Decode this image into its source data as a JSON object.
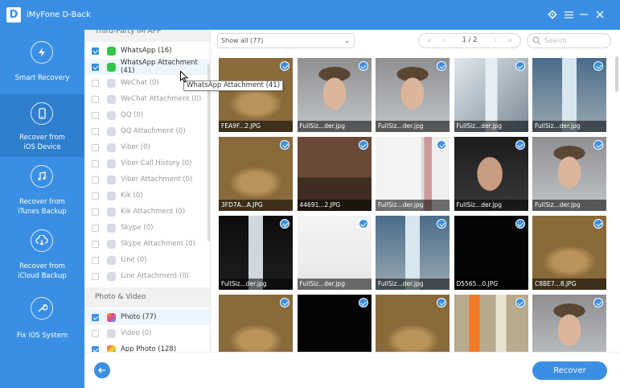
{
  "window": {
    "title": "iMyFone D-Back",
    "logo_letter": "D"
  },
  "sidebar": {
    "items": [
      {
        "label": "Smart Recovery",
        "icon": "lightning-refresh-icon",
        "active": false
      },
      {
        "label": "Recover from iOS Device",
        "icon": "phone-refresh-icon",
        "active": true
      },
      {
        "label": "Recover from iTunes Backup",
        "icon": "music-note-icon",
        "active": false
      },
      {
        "label": "Recover from iCloud Backup",
        "icon": "cloud-download-icon",
        "active": false
      },
      {
        "label": "Fix iOS System",
        "icon": "wrench-icon",
        "active": false
      }
    ]
  },
  "categories": {
    "section1": "Third-Party IM APP",
    "third_party": [
      {
        "label": "WhatsApp (16)",
        "checked": true,
        "active": true,
        "icon": "whatsapp-icon"
      },
      {
        "label": "WhatsApp Attachment (41)",
        "checked": true,
        "active": true,
        "icon": "whatsapp-icon"
      },
      {
        "label": "WeChat (0)",
        "checked": false,
        "active": false,
        "icon": "wechat-icon"
      },
      {
        "label": "WeChat Attachment (0)",
        "checked": false,
        "active": false,
        "icon": "wechat-icon"
      },
      {
        "label": "QQ (0)",
        "checked": false,
        "active": false,
        "icon": "qq-icon"
      },
      {
        "label": "QQ Attachment (0)",
        "checked": false,
        "active": false,
        "icon": "qq-icon"
      },
      {
        "label": "Viber (0)",
        "checked": false,
        "active": false,
        "icon": "viber-icon"
      },
      {
        "label": "Viber Call History (0)",
        "checked": false,
        "active": false,
        "icon": "viber-icon"
      },
      {
        "label": "Viber Attachment (0)",
        "checked": false,
        "active": false,
        "icon": "viber-icon"
      },
      {
        "label": "Kik (0)",
        "checked": false,
        "active": false,
        "icon": "kik-icon"
      },
      {
        "label": "Kik Attachment (0)",
        "checked": false,
        "active": false,
        "icon": "kik-icon"
      },
      {
        "label": "Skype (0)",
        "checked": false,
        "active": false,
        "icon": "skype-icon"
      },
      {
        "label": "Skype Attachment (0)",
        "checked": false,
        "active": false,
        "icon": "skype-icon"
      },
      {
        "label": "Line (0)",
        "checked": false,
        "active": false,
        "icon": "line-icon"
      },
      {
        "label": "Line Attachment (0)",
        "checked": false,
        "active": false,
        "icon": "line-icon"
      }
    ],
    "section2": "Photo & Video",
    "photo_video": [
      {
        "label": "Photo (77)",
        "checked": true,
        "active": true,
        "icon": "photo-icon"
      },
      {
        "label": "Video (0)",
        "checked": false,
        "active": false,
        "icon": "video-icon"
      },
      {
        "label": "App Photo (128)",
        "checked": true,
        "active": true,
        "icon": "app-photo-icon"
      }
    ]
  },
  "tooltip": "WhatsApp Attachment (41)",
  "toolbar": {
    "filter_value": "Show all (77)",
    "page": "1 / 2",
    "search_placeholder": "Search"
  },
  "thumbnails": [
    {
      "caption": "FEA9F...2.JPG",
      "scene": "potato"
    },
    {
      "caption": "FullSiz...der.jpg",
      "scene": "man"
    },
    {
      "caption": "FullSiz...der.jpg",
      "scene": "man"
    },
    {
      "caption": "FullSiz...der.jpg",
      "scene": "bottle-window"
    },
    {
      "caption": "FullSiz...der.jpg",
      "scene": "bottle"
    },
    {
      "caption": "3FD7A...A.JPG",
      "scene": "potato"
    },
    {
      "caption": "44691...2.JPG",
      "scene": "room"
    },
    {
      "caption": "FullSiz...der.jpg",
      "scene": "doc"
    },
    {
      "caption": "FullSiz...der.jpg",
      "scene": "man-dark"
    },
    {
      "caption": "FullSiz...der.jpg",
      "scene": "man"
    },
    {
      "caption": "FullSiz...der.jpg",
      "scene": "bottle-dark"
    },
    {
      "caption": "FullSiz...der.jpg",
      "scene": "note"
    },
    {
      "caption": "FullSiz...der.jpg",
      "scene": "bottle"
    },
    {
      "caption": "D5565...0.JPG",
      "scene": "black"
    },
    {
      "caption": "C8BE7...8.JPG",
      "scene": "potato"
    },
    {
      "caption": "",
      "scene": "potato"
    },
    {
      "caption": "",
      "scene": "black"
    },
    {
      "caption": "",
      "scene": "potato"
    },
    {
      "caption": "",
      "scene": "bottles"
    },
    {
      "caption": "",
      "scene": "man"
    }
  ],
  "footer": {
    "recover_label": "Recover"
  }
}
